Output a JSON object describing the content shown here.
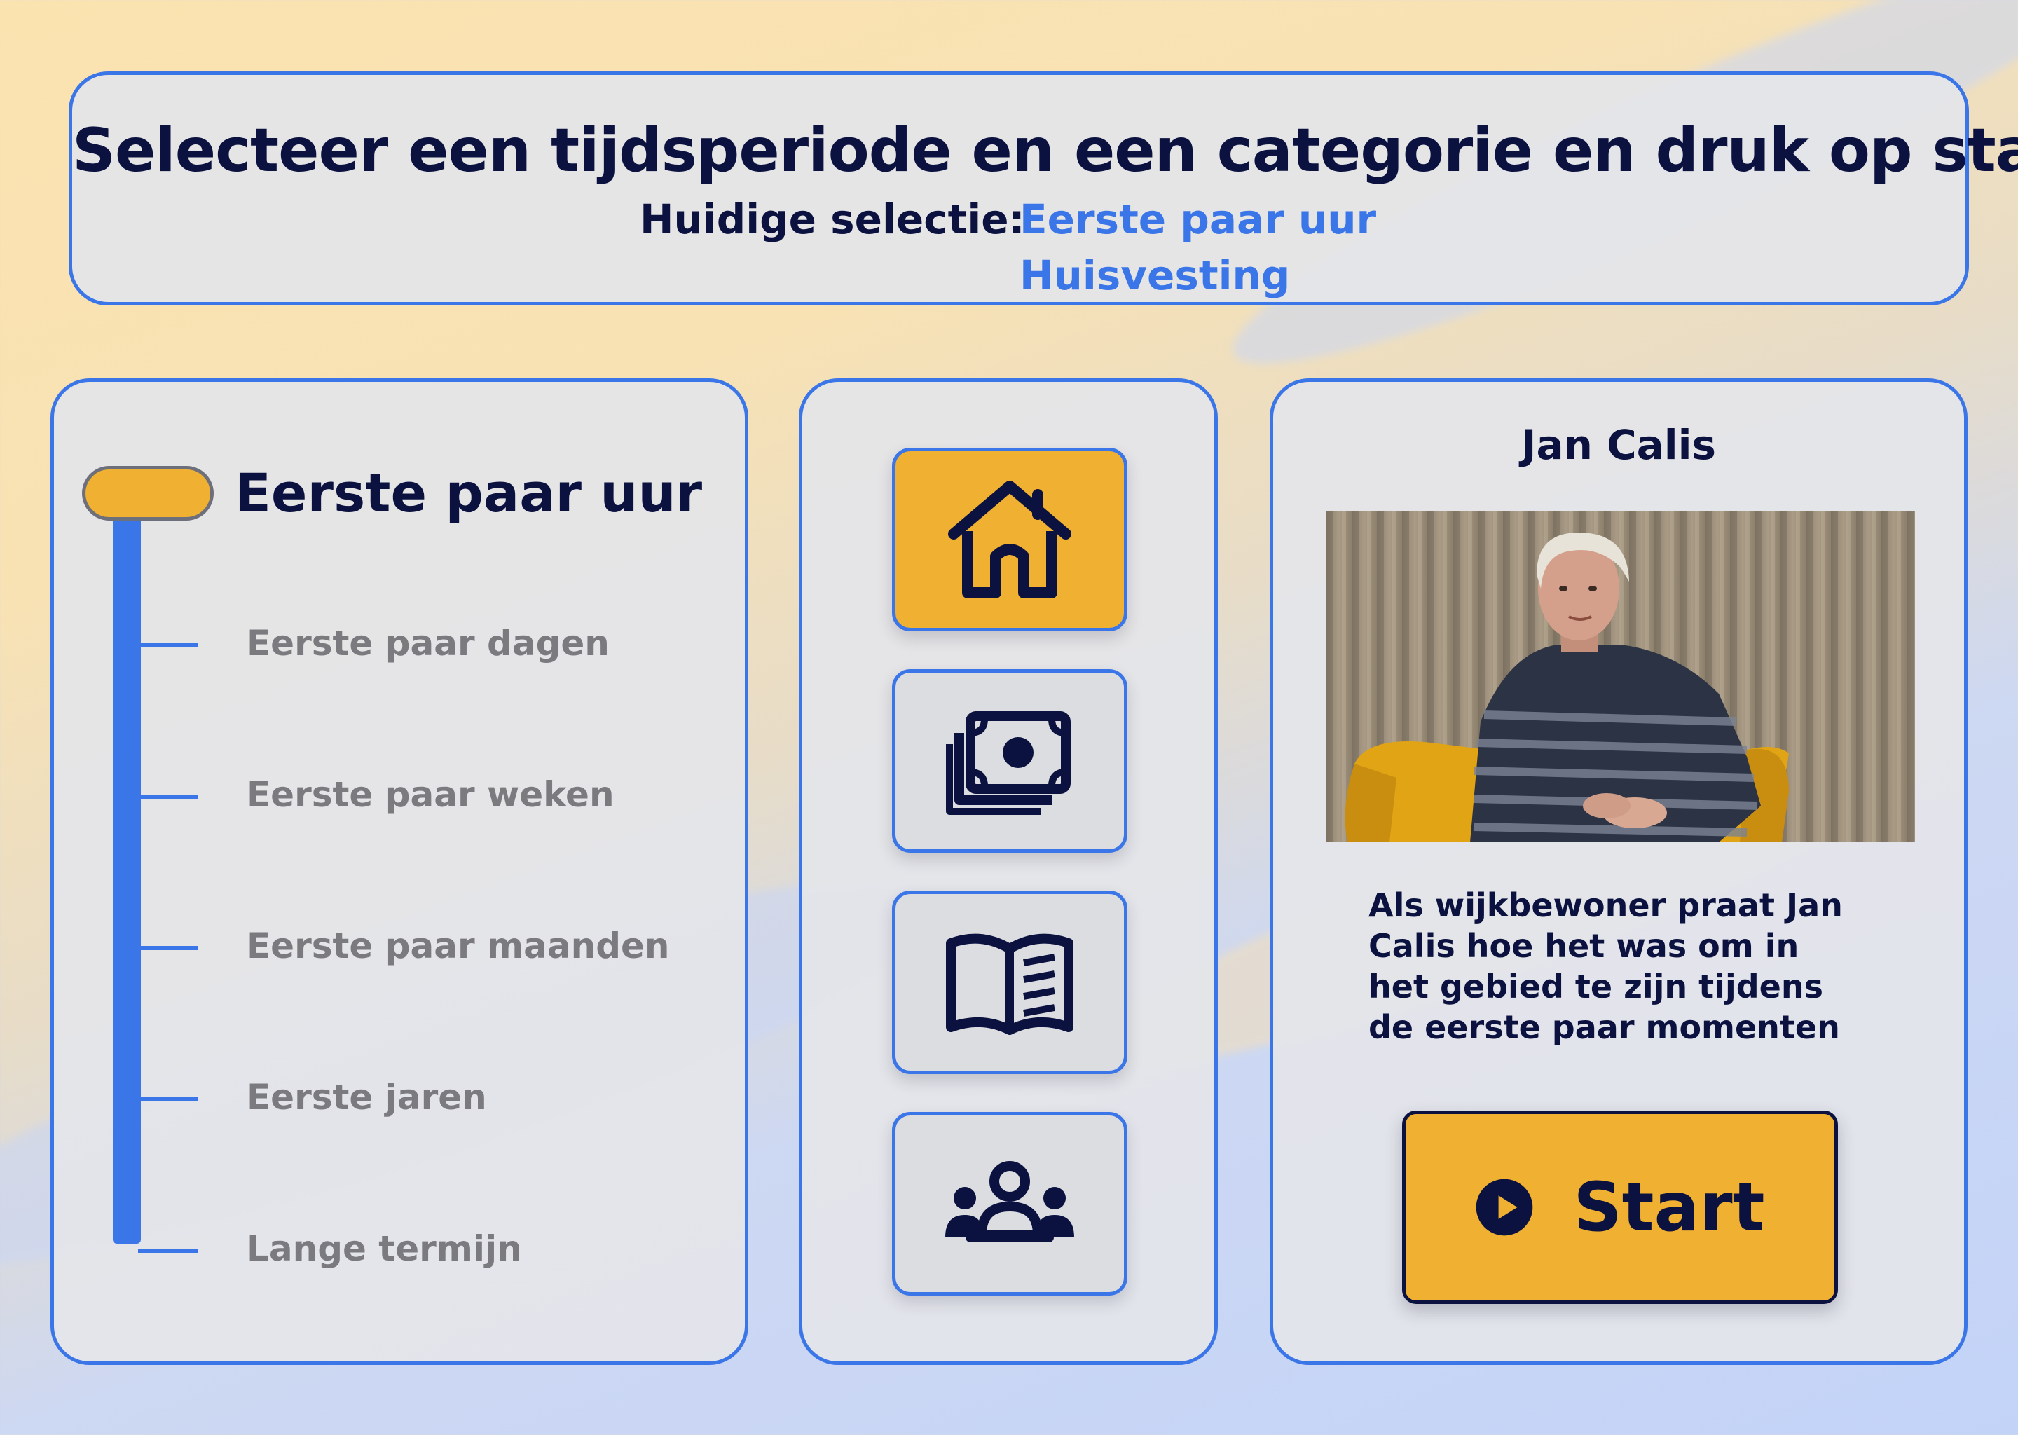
{
  "header": {
    "title": "Selecteer een tijdsperiode en een categorie en druk op start",
    "selection_label": "Huidige selectie:",
    "selection_time": "Eerste paar uur",
    "selection_category": "Huisvesting"
  },
  "timeline": {
    "selected_label": "Eerste paar uur",
    "options": [
      "Eerste paar dagen",
      "Eerste paar weken",
      "Eerste paar maanden",
      "Eerste jaren",
      "Lange termijn"
    ]
  },
  "categories": [
    {
      "icon": "house-icon",
      "active": true
    },
    {
      "icon": "money-icon",
      "active": false
    },
    {
      "icon": "book-icon",
      "active": false
    },
    {
      "icon": "group-icon",
      "active": false
    }
  ],
  "info": {
    "name": "Jan Calis",
    "description": "Als wijkbewoner praat Jan Calis hoe het was om in het gebied te zijn tijdens de eerste paar momenten",
    "start_label": "Start"
  },
  "colors": {
    "accent": "#3b76e8",
    "highlight": "#f0b132",
    "text_dark": "#0b1240",
    "text_muted": "#7b7b7f"
  }
}
